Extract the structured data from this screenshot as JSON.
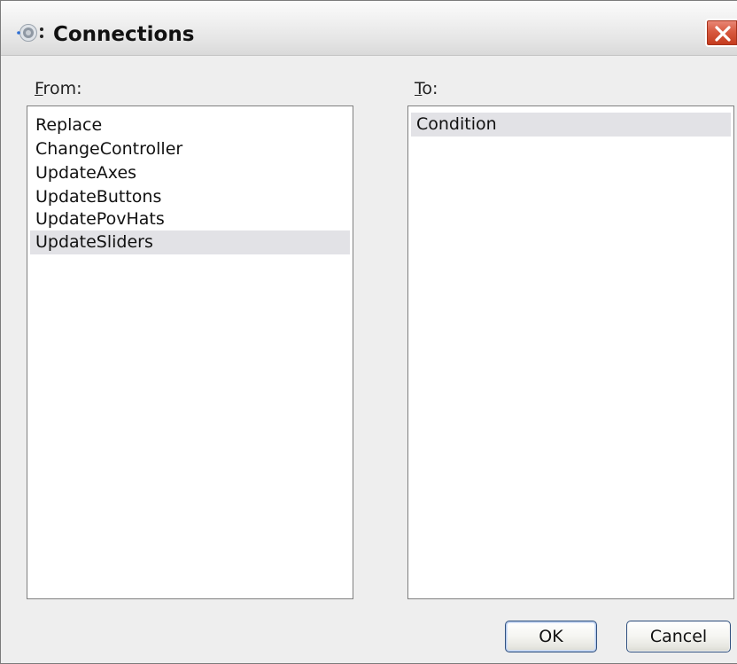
{
  "window": {
    "title": "Connections",
    "icon": "gear-icon",
    "close_icon": "close-icon"
  },
  "from": {
    "label_mnemonic": "F",
    "label_rest": "rom:",
    "items": [
      {
        "label": "Replace",
        "selected": false
      },
      {
        "label": "ChangeController",
        "selected": false
      },
      {
        "label": "UpdateAxes",
        "selected": false
      },
      {
        "label": "UpdateButtons",
        "selected": false
      },
      {
        "label": "UpdatePovHats",
        "selected": false
      },
      {
        "label": "UpdateSliders",
        "selected": true
      }
    ]
  },
  "to": {
    "label_mnemonic": "T",
    "label_rest": "o:",
    "items": [
      {
        "label": "Condition",
        "selected": true
      }
    ]
  },
  "buttons": {
    "ok_label": "OK",
    "cancel_label": "Cancel"
  },
  "colors": {
    "close_button": "#d85a40",
    "selection": "#e2e2e6",
    "button_border": "#305180"
  }
}
